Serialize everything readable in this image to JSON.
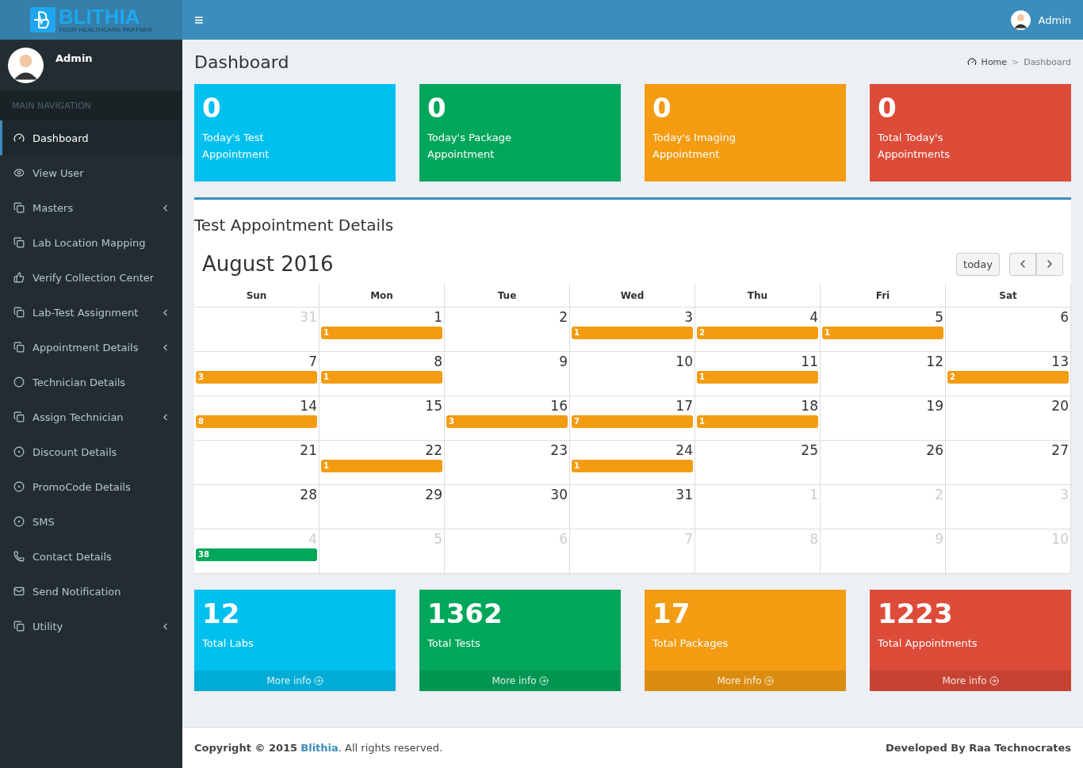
{
  "brand": {
    "name": "BLITHIA",
    "tagline": "YOUR HEALTHCARE PARTNER"
  },
  "header": {
    "menu_glyph": "≡",
    "user": "Admin"
  },
  "sidebar": {
    "user": "Admin",
    "section": "MAIN NAVIGATION",
    "items": [
      {
        "label": "Dashboard",
        "kind": "gauge",
        "caret": false,
        "selected": true
      },
      {
        "label": "View User",
        "kind": "eye",
        "caret": false,
        "selected": false
      },
      {
        "label": "Masters",
        "kind": "copy",
        "caret": true,
        "selected": false
      },
      {
        "label": "Lab Location Mapping",
        "kind": "copy",
        "caret": false,
        "selected": false
      },
      {
        "label": "Verify Collection Center",
        "kind": "thumb",
        "caret": false,
        "selected": false
      },
      {
        "label": "Lab-Test Assignment",
        "kind": "copy",
        "caret": true,
        "selected": false
      },
      {
        "label": "Appointment Details",
        "kind": "copy",
        "caret": true,
        "selected": false
      },
      {
        "label": "Technician Details",
        "kind": "circle",
        "caret": false,
        "selected": false
      },
      {
        "label": "Assign Technician",
        "kind": "copy",
        "caret": true,
        "selected": false
      },
      {
        "label": "Discount Details",
        "kind": "dot",
        "caret": false,
        "selected": false
      },
      {
        "label": "PromoCode Details",
        "kind": "dot",
        "caret": false,
        "selected": false
      },
      {
        "label": "SMS",
        "kind": "dot",
        "caret": false,
        "selected": false
      },
      {
        "label": "Contact Details",
        "kind": "phone",
        "caret": false,
        "selected": false
      },
      {
        "label": "Send Notification",
        "kind": "mail",
        "caret": false,
        "selected": false
      },
      {
        "label": "Utility",
        "kind": "copy",
        "caret": true,
        "selected": false
      }
    ]
  },
  "page": {
    "title": "Dashboard",
    "breadcrumb": [
      "Home",
      "Dashboard"
    ],
    "breadcrumb_separator": ">"
  },
  "today_boxes": [
    {
      "value": "0",
      "label": "Today's Test Appointment",
      "color": "#00c0ef"
    },
    {
      "value": "0",
      "label": "Today's Package Appointment",
      "color": "#00a65a"
    },
    {
      "value": "0",
      "label": "Today's Imaging Appointment",
      "color": "#f39c12"
    },
    {
      "value": "0",
      "label": "Total Today's Appointments",
      "color": "#dd4b39"
    }
  ],
  "calendar": {
    "panel_title": "Test Appointment Details",
    "month": "August 2016",
    "today_button": "today",
    "weekdays": [
      "Sun",
      "Mon",
      "Tue",
      "Wed",
      "Thu",
      "Fri",
      "Sat"
    ],
    "weeks": [
      [
        {
          "day": "31",
          "other": true
        },
        {
          "day": "1",
          "other": false,
          "event": {
            "label": "1",
            "color": "#f39c12"
          }
        },
        {
          "day": "2",
          "other": false
        },
        {
          "day": "3",
          "other": false,
          "event": {
            "label": "1",
            "color": "#f39c12"
          }
        },
        {
          "day": "4",
          "other": false,
          "event": {
            "label": "2",
            "color": "#f39c12"
          }
        },
        {
          "day": "5",
          "other": false,
          "event": {
            "label": "1",
            "color": "#f39c12"
          }
        },
        {
          "day": "6",
          "other": false
        }
      ],
      [
        {
          "day": "7",
          "other": false,
          "event": {
            "label": "3",
            "color": "#f39c12"
          }
        },
        {
          "day": "8",
          "other": false,
          "event": {
            "label": "1",
            "color": "#f39c12"
          }
        },
        {
          "day": "9",
          "other": false
        },
        {
          "day": "10",
          "other": false
        },
        {
          "day": "11",
          "other": false,
          "event": {
            "label": "1",
            "color": "#f39c12"
          }
        },
        {
          "day": "12",
          "other": false
        },
        {
          "day": "13",
          "other": false,
          "event": {
            "label": "2",
            "color": "#f39c12"
          }
        }
      ],
      [
        {
          "day": "14",
          "other": false,
          "event": {
            "label": "8",
            "color": "#f39c12"
          }
        },
        {
          "day": "15",
          "other": false
        },
        {
          "day": "16",
          "other": false,
          "event": {
            "label": "3",
            "color": "#f39c12"
          }
        },
        {
          "day": "17",
          "other": false,
          "event": {
            "label": "7",
            "color": "#f39c12"
          }
        },
        {
          "day": "18",
          "other": false,
          "event": {
            "label": "1",
            "color": "#f39c12"
          }
        },
        {
          "day": "19",
          "other": false
        },
        {
          "day": "20",
          "other": false
        }
      ],
      [
        {
          "day": "21",
          "other": false
        },
        {
          "day": "22",
          "other": false,
          "event": {
            "label": "1",
            "color": "#f39c12"
          }
        },
        {
          "day": "23",
          "other": false
        },
        {
          "day": "24",
          "other": false,
          "event": {
            "label": "1",
            "color": "#f39c12"
          }
        },
        {
          "day": "25",
          "other": false
        },
        {
          "day": "26",
          "other": false
        },
        {
          "day": "27",
          "other": false
        }
      ],
      [
        {
          "day": "28",
          "other": false
        },
        {
          "day": "29",
          "other": false
        },
        {
          "day": "30",
          "other": false
        },
        {
          "day": "31",
          "other": false
        },
        {
          "day": "1",
          "other": true
        },
        {
          "day": "2",
          "other": true
        },
        {
          "day": "3",
          "other": true
        }
      ],
      [
        {
          "day": "4",
          "other": true,
          "event": {
            "label": "38",
            "color": "#00a65a"
          }
        },
        {
          "day": "5",
          "other": true
        },
        {
          "day": "6",
          "other": true
        },
        {
          "day": "7",
          "other": true
        },
        {
          "day": "8",
          "other": true
        },
        {
          "day": "9",
          "other": true
        },
        {
          "day": "10",
          "other": true
        }
      ]
    ]
  },
  "total_boxes": [
    {
      "value": "12",
      "label": "Total Labs",
      "link": "More info",
      "color": "#00c0ef"
    },
    {
      "value": "1362",
      "label": "Total Tests",
      "link": "More info",
      "color": "#00a65a"
    },
    {
      "value": "17",
      "label": "Total Packages",
      "link": "More info",
      "color": "#f39c12"
    },
    {
      "value": "1223",
      "label": "Total Appointments",
      "link": "More info",
      "color": "#dd4b39"
    }
  ],
  "footer": {
    "copyright": "**Copyright © 2015** ",
    "brand_link": "Blithia",
    "rights": ". All rights reserved.",
    "developer": "Developed By Raa Technocrates"
  }
}
